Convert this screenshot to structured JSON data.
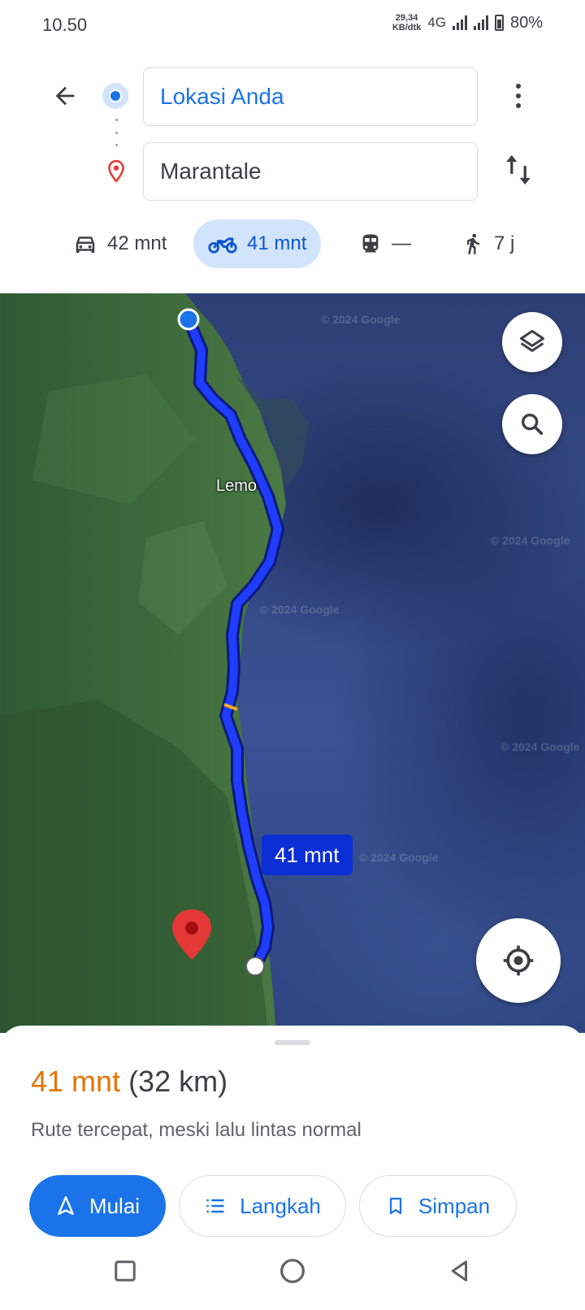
{
  "status_bar": {
    "time": "10.50",
    "net_speed_value": "29,34",
    "net_speed_unit": "KB/dtk",
    "network": "4G",
    "battery": "80%"
  },
  "directions": {
    "origin": "Lokasi Anda",
    "destination": "Marantale"
  },
  "modes": [
    {
      "name": "car",
      "label": "42 mnt",
      "selected": false
    },
    {
      "name": "motorcycle",
      "label": "41 mnt",
      "selected": true
    },
    {
      "name": "transit",
      "label": "—",
      "selected": false
    },
    {
      "name": "walk",
      "label": "7 j",
      "selected": false
    }
  ],
  "map": {
    "place_label": "Lemo",
    "eta_callout": "41 mnt",
    "watermark": "© 2024 Google",
    "route_color": "#1f3cff",
    "destination_pin_color": "#e53935"
  },
  "route_summary": {
    "duration": "41 mnt",
    "distance": "(32 km)",
    "description": "Rute tercepat, meski lalu lintas normal"
  },
  "actions": {
    "start": "Mulai",
    "steps": "Langkah",
    "save": "Simpan"
  },
  "colors": {
    "accent": "#1a73e8",
    "duration_orange": "#e37400",
    "selected_mode_bg": "#d2e3fc"
  }
}
